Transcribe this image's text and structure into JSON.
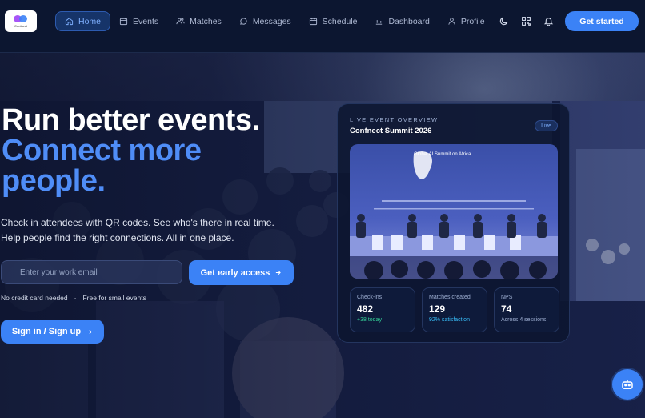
{
  "brand": {
    "logo_text": "Confnect"
  },
  "nav": {
    "items": [
      {
        "label": "Home",
        "icon": "home-icon",
        "active": true
      },
      {
        "label": "Events",
        "icon": "calendar-icon"
      },
      {
        "label": "Matches",
        "icon": "users-icon"
      },
      {
        "label": "Messages",
        "icon": "chat-icon"
      },
      {
        "label": "Schedule",
        "icon": "calendar-icon"
      },
      {
        "label": "Dashboard",
        "icon": "bar-chart-icon"
      },
      {
        "label": "Profile",
        "icon": "user-icon"
      }
    ],
    "cta_label": "Get started"
  },
  "hero": {
    "title_line1": "Run better events.",
    "title_line2": "Connect more",
    "title_line3": "people.",
    "lead_line1": "Check in attendees with QR codes. See who's there in real time.",
    "lead_line2": "Help people find the right connections. All in one place.",
    "email_placeholder": "Enter your work email",
    "early_access_label": "Get early access",
    "note1": "No credit card needed",
    "note_sep": "·",
    "note2": "Free for small events",
    "signin_label": "Sign in / Sign up"
  },
  "overview": {
    "eyebrow": "LIVE EVENT OVERVIEW",
    "title": "Confnect Summit 2026",
    "badge": "Live",
    "stage_banner": "Global AI Summit on Africa",
    "stats": [
      {
        "label": "Check-ins",
        "value": "482",
        "sub": "+38 today",
        "sub_color": "#34d399"
      },
      {
        "label": "Matches created",
        "value": "129",
        "sub": "92% satisfaction",
        "sub_color": "#38bdf8"
      },
      {
        "label": "NPS",
        "value": "74",
        "sub": "Across 4 sessions",
        "sub_color": "#9fb0d3"
      }
    ]
  },
  "colors": {
    "accent": "#3b82f6",
    "title_blue": "#4f8df7",
    "bg": "#0b1226"
  }
}
